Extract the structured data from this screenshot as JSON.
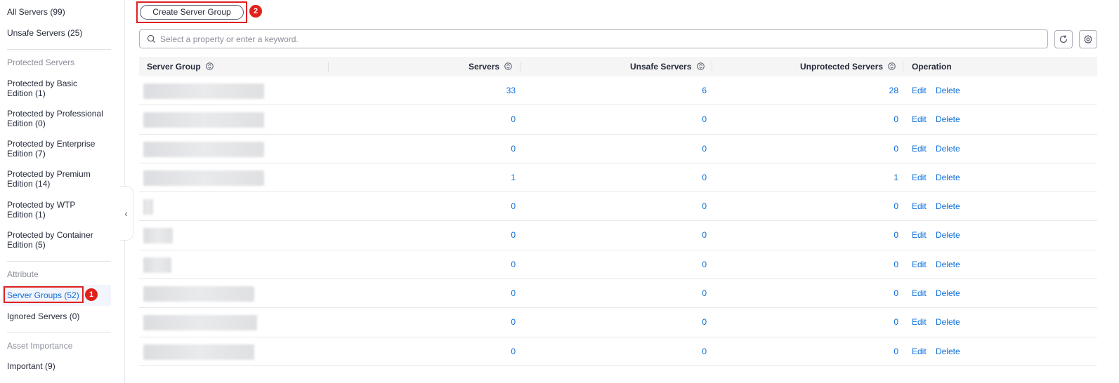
{
  "sidebar": {
    "all_servers": "All Servers (99)",
    "unsafe_servers": "Unsafe Servers (25)",
    "protected_group": "Protected Servers",
    "protected": [
      [
        "Protected by Basic",
        "Edition (1)"
      ],
      [
        "Protected by Professional",
        "Edition (0)"
      ],
      [
        "Protected by Enterprise",
        "Edition (7)"
      ],
      [
        "Protected by Premium",
        "Edition (14)"
      ],
      [
        "Protected by WTP",
        "Edition (1)"
      ],
      [
        "Protected by Container",
        "Edition (5)"
      ]
    ],
    "attribute_group": "Attribute",
    "server_groups": "Server Groups (52)",
    "ignored_servers": "Ignored Servers (0)",
    "importance_group": "Asset Importance",
    "important": "Important (9)",
    "badge1": "1"
  },
  "toolbar": {
    "create_label": "Create Server Group",
    "badge2": "2",
    "search_placeholder": "Select a property or enter a keyword."
  },
  "table": {
    "headers": {
      "server_group": "Server Group",
      "servers": "Servers",
      "unsafe": "Unsafe Servers",
      "unprotected": "Unprotected Servers",
      "operation": "Operation"
    },
    "rows": [
      {
        "servers": "33",
        "unsafe": "6",
        "unprotected": "28"
      },
      {
        "servers": "0",
        "unsafe": "0",
        "unprotected": "0"
      },
      {
        "servers": "0",
        "unsafe": "0",
        "unprotected": "0"
      },
      {
        "servers": "1",
        "unsafe": "0",
        "unprotected": "1"
      },
      {
        "servers": "0",
        "unsafe": "0",
        "unprotected": "0"
      },
      {
        "servers": "0",
        "unsafe": "0",
        "unprotected": "0"
      },
      {
        "servers": "0",
        "unsafe": "0",
        "unprotected": "0"
      },
      {
        "servers": "0",
        "unsafe": "0",
        "unprotected": "0"
      },
      {
        "servers": "0",
        "unsafe": "0",
        "unprotected": "0"
      },
      {
        "servers": "0",
        "unsafe": "0",
        "unprotected": "0"
      }
    ],
    "edit_label": "Edit",
    "delete_label": "Delete"
  }
}
